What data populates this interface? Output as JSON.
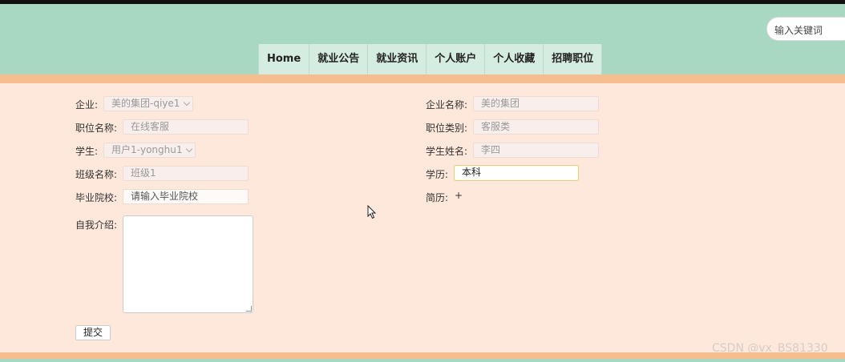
{
  "search": {
    "placeholder": "输入关键词"
  },
  "nav": {
    "items": [
      "Home",
      "就业公告",
      "就业资讯",
      "个人账户",
      "个人收藏",
      "招聘职位"
    ]
  },
  "form": {
    "enterprise": {
      "label": "企业:",
      "value": "美的集团-qiye1"
    },
    "enterprise_name": {
      "label": "企业名称:",
      "value": "美的集团"
    },
    "position_name": {
      "label": "职位名称:",
      "value": "在线客服"
    },
    "position_type": {
      "label": "职位类别:",
      "value": "客服类"
    },
    "student": {
      "label": "学生:",
      "value": "用户1-yonghu1"
    },
    "student_name": {
      "label": "学生姓名:",
      "value": "李四"
    },
    "class_name": {
      "label": "班级名称:",
      "value": "班级1"
    },
    "education": {
      "label": "学历:",
      "value": "本科"
    },
    "school": {
      "label": "毕业院校:",
      "placeholder": "请输入毕业院校"
    },
    "resume": {
      "label": "简历:",
      "add_symbol": "+"
    },
    "intro": {
      "label": "自我介绍:",
      "value": ""
    },
    "submit_label": "提交"
  },
  "watermark": "CSDN @vx_BS81330"
}
